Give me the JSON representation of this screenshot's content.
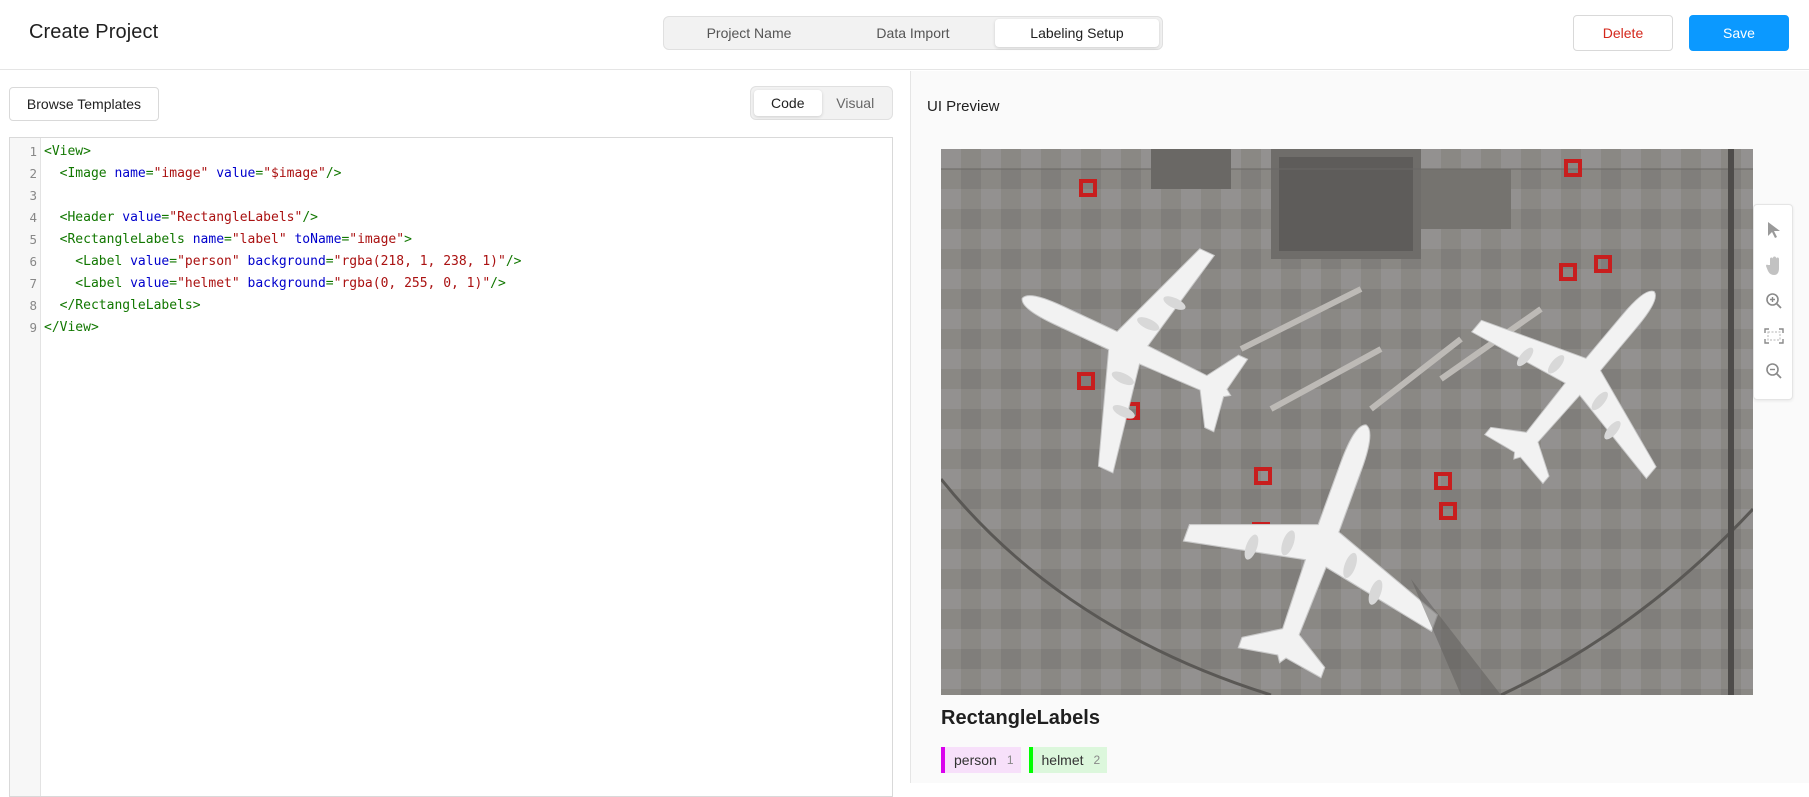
{
  "header": {
    "title": "Create Project",
    "steps": [
      "Project Name",
      "Data Import",
      "Labeling Setup"
    ],
    "delete_label": "Delete",
    "save_label": "Save"
  },
  "left": {
    "browse_label": "Browse Templates",
    "modes": [
      "Code",
      "Visual"
    ]
  },
  "editor": {
    "line_numbers": [
      "1",
      "2",
      "3",
      "4",
      "5",
      "6",
      "7",
      "8",
      "9"
    ],
    "lines": [
      [
        [
          "tag",
          "<View>"
        ]
      ],
      [
        [
          "tag",
          "  <Image "
        ],
        [
          "attr",
          "name"
        ],
        [
          "punc",
          "="
        ],
        [
          "str",
          "\"image\""
        ],
        [
          "tag",
          " "
        ],
        [
          "attr",
          "value"
        ],
        [
          "punc",
          "="
        ],
        [
          "str",
          "\"$image\""
        ],
        [
          "tag",
          "/>"
        ]
      ],
      [],
      [
        [
          "tag",
          "  <Header "
        ],
        [
          "attr",
          "value"
        ],
        [
          "punc",
          "="
        ],
        [
          "str",
          "\"RectangleLabels\""
        ],
        [
          "tag",
          "/>"
        ]
      ],
      [
        [
          "tag",
          "  <RectangleLabels "
        ],
        [
          "attr",
          "name"
        ],
        [
          "punc",
          "="
        ],
        [
          "str",
          "\"label\""
        ],
        [
          "tag",
          " "
        ],
        [
          "attr",
          "toName"
        ],
        [
          "punc",
          "="
        ],
        [
          "str",
          "\"image\""
        ],
        [
          "tag",
          ">"
        ]
      ],
      [
        [
          "tag",
          "    <Label "
        ],
        [
          "attr",
          "value"
        ],
        [
          "punc",
          "="
        ],
        [
          "str",
          "\"person\""
        ],
        [
          "tag",
          " "
        ],
        [
          "attr",
          "background"
        ],
        [
          "punc",
          "="
        ],
        [
          "str",
          "\"rgba(218, 1, 238, 1)\""
        ],
        [
          "tag",
          "/>"
        ]
      ],
      [
        [
          "tag",
          "    <Label "
        ],
        [
          "attr",
          "value"
        ],
        [
          "punc",
          "="
        ],
        [
          "str",
          "\"helmet\""
        ],
        [
          "tag",
          " "
        ],
        [
          "attr",
          "background"
        ],
        [
          "punc",
          "="
        ],
        [
          "str",
          "\"rgba(0, 255, 0, 1)\""
        ],
        [
          "tag",
          "/>"
        ]
      ],
      [
        [
          "tag",
          "  </RectangleLabels>"
        ]
      ],
      [
        [
          "tag",
          "</View>"
        ]
      ]
    ]
  },
  "preview": {
    "title": "UI Preview",
    "tools": [
      "pointer-icon",
      "hand-icon",
      "zoom-in-icon",
      "fit-screen-icon",
      "zoom-out-icon"
    ],
    "header": "RectangleLabels",
    "labels": [
      {
        "name": "person",
        "hotkey": "1",
        "color": "#da01ee",
        "bg": "#f7e0fa"
      },
      {
        "name": "helmet",
        "hotkey": "2",
        "color": "#00ff00",
        "bg": "#dcf7dc"
      }
    ]
  }
}
